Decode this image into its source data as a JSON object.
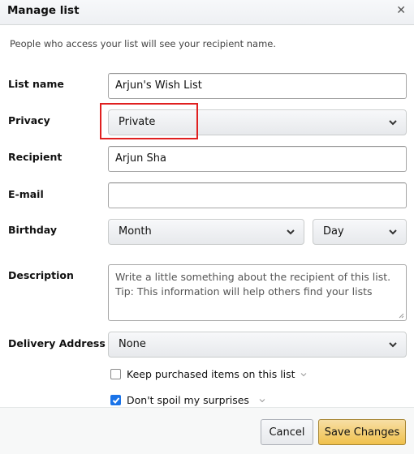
{
  "dialog": {
    "title": "Manage list",
    "close_icon": "close-icon",
    "note": "People who access your list will see your recipient name."
  },
  "form": {
    "list_name": {
      "label": "List name",
      "value": "Arjun's Wish List"
    },
    "privacy": {
      "label": "Privacy",
      "selected": "Private"
    },
    "recipient": {
      "label": "Recipient",
      "value": "Arjun Sha"
    },
    "email": {
      "label": "E-mail",
      "value": ""
    },
    "birthday": {
      "label": "Birthday",
      "month": "Month",
      "day": "Day"
    },
    "description": {
      "label": "Description",
      "placeholder_line1": "Write a little something about the recipient of this list.",
      "placeholder_line2": "Tip: This information will help others find your lists"
    },
    "delivery_address": {
      "label": "Delivery Address",
      "selected": "None"
    },
    "keep_purchased": {
      "label": "Keep purchased items on this list",
      "checked": false
    },
    "dont_spoil": {
      "label": "Don't spoil my surprises",
      "checked": true
    }
  },
  "footer": {
    "cancel_label": "Cancel",
    "save_label": "Save Changes"
  },
  "annotation": {
    "highlight_color": "#e02020",
    "highlight_target": "privacy-select"
  },
  "colors": {
    "save_button": "#f0c14b",
    "checkbox_checked": "#1a73e8"
  }
}
